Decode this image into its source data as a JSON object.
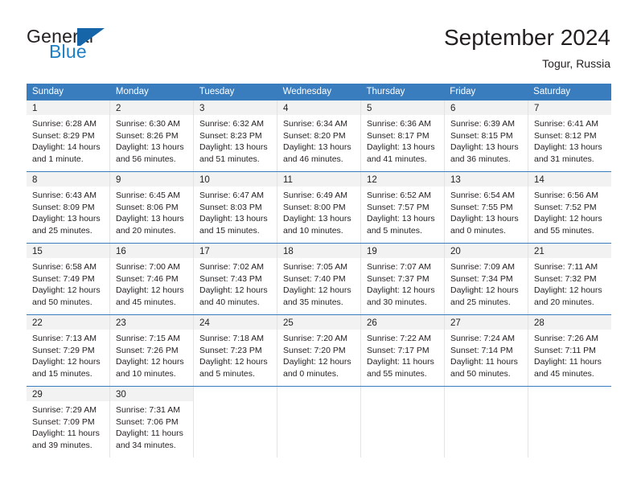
{
  "brand": {
    "name_part1": "General",
    "name_part2": "Blue",
    "flag_color": "#1665a8",
    "blue_text_color": "#1f7fc4"
  },
  "header": {
    "title": "September 2024",
    "location": "Togur, Russia"
  },
  "theme": {
    "header_row_bg": "#3a7dbf",
    "daynum_band_bg": "#f2f2f2",
    "cell_border": "#e3e3e3",
    "text": "#231f20"
  },
  "weekdays": [
    "Sunday",
    "Monday",
    "Tuesday",
    "Wednesday",
    "Thursday",
    "Friday",
    "Saturday"
  ],
  "labels": {
    "sunrise_prefix": "Sunrise:",
    "sunset_prefix": "Sunset:",
    "daylight_prefix": "Daylight:"
  },
  "weeks": [
    [
      {
        "day": "1",
        "sunrise": "Sunrise: 6:28 AM",
        "sunset": "Sunset: 8:29 PM",
        "daylight1": "Daylight: 14 hours",
        "daylight2": "and 1 minute."
      },
      {
        "day": "2",
        "sunrise": "Sunrise: 6:30 AM",
        "sunset": "Sunset: 8:26 PM",
        "daylight1": "Daylight: 13 hours",
        "daylight2": "and 56 minutes."
      },
      {
        "day": "3",
        "sunrise": "Sunrise: 6:32 AM",
        "sunset": "Sunset: 8:23 PM",
        "daylight1": "Daylight: 13 hours",
        "daylight2": "and 51 minutes."
      },
      {
        "day": "4",
        "sunrise": "Sunrise: 6:34 AM",
        "sunset": "Sunset: 8:20 PM",
        "daylight1": "Daylight: 13 hours",
        "daylight2": "and 46 minutes."
      },
      {
        "day": "5",
        "sunrise": "Sunrise: 6:36 AM",
        "sunset": "Sunset: 8:17 PM",
        "daylight1": "Daylight: 13 hours",
        "daylight2": "and 41 minutes."
      },
      {
        "day": "6",
        "sunrise": "Sunrise: 6:39 AM",
        "sunset": "Sunset: 8:15 PM",
        "daylight1": "Daylight: 13 hours",
        "daylight2": "and 36 minutes."
      },
      {
        "day": "7",
        "sunrise": "Sunrise: 6:41 AM",
        "sunset": "Sunset: 8:12 PM",
        "daylight1": "Daylight: 13 hours",
        "daylight2": "and 31 minutes."
      }
    ],
    [
      {
        "day": "8",
        "sunrise": "Sunrise: 6:43 AM",
        "sunset": "Sunset: 8:09 PM",
        "daylight1": "Daylight: 13 hours",
        "daylight2": "and 25 minutes."
      },
      {
        "day": "9",
        "sunrise": "Sunrise: 6:45 AM",
        "sunset": "Sunset: 8:06 PM",
        "daylight1": "Daylight: 13 hours",
        "daylight2": "and 20 minutes."
      },
      {
        "day": "10",
        "sunrise": "Sunrise: 6:47 AM",
        "sunset": "Sunset: 8:03 PM",
        "daylight1": "Daylight: 13 hours",
        "daylight2": "and 15 minutes."
      },
      {
        "day": "11",
        "sunrise": "Sunrise: 6:49 AM",
        "sunset": "Sunset: 8:00 PM",
        "daylight1": "Daylight: 13 hours",
        "daylight2": "and 10 minutes."
      },
      {
        "day": "12",
        "sunrise": "Sunrise: 6:52 AM",
        "sunset": "Sunset: 7:57 PM",
        "daylight1": "Daylight: 13 hours",
        "daylight2": "and 5 minutes."
      },
      {
        "day": "13",
        "sunrise": "Sunrise: 6:54 AM",
        "sunset": "Sunset: 7:55 PM",
        "daylight1": "Daylight: 13 hours",
        "daylight2": "and 0 minutes."
      },
      {
        "day": "14",
        "sunrise": "Sunrise: 6:56 AM",
        "sunset": "Sunset: 7:52 PM",
        "daylight1": "Daylight: 12 hours",
        "daylight2": "and 55 minutes."
      }
    ],
    [
      {
        "day": "15",
        "sunrise": "Sunrise: 6:58 AM",
        "sunset": "Sunset: 7:49 PM",
        "daylight1": "Daylight: 12 hours",
        "daylight2": "and 50 minutes."
      },
      {
        "day": "16",
        "sunrise": "Sunrise: 7:00 AM",
        "sunset": "Sunset: 7:46 PM",
        "daylight1": "Daylight: 12 hours",
        "daylight2": "and 45 minutes."
      },
      {
        "day": "17",
        "sunrise": "Sunrise: 7:02 AM",
        "sunset": "Sunset: 7:43 PM",
        "daylight1": "Daylight: 12 hours",
        "daylight2": "and 40 minutes."
      },
      {
        "day": "18",
        "sunrise": "Sunrise: 7:05 AM",
        "sunset": "Sunset: 7:40 PM",
        "daylight1": "Daylight: 12 hours",
        "daylight2": "and 35 minutes."
      },
      {
        "day": "19",
        "sunrise": "Sunrise: 7:07 AM",
        "sunset": "Sunset: 7:37 PM",
        "daylight1": "Daylight: 12 hours",
        "daylight2": "and 30 minutes."
      },
      {
        "day": "20",
        "sunrise": "Sunrise: 7:09 AM",
        "sunset": "Sunset: 7:34 PM",
        "daylight1": "Daylight: 12 hours",
        "daylight2": "and 25 minutes."
      },
      {
        "day": "21",
        "sunrise": "Sunrise: 7:11 AM",
        "sunset": "Sunset: 7:32 PM",
        "daylight1": "Daylight: 12 hours",
        "daylight2": "and 20 minutes."
      }
    ],
    [
      {
        "day": "22",
        "sunrise": "Sunrise: 7:13 AM",
        "sunset": "Sunset: 7:29 PM",
        "daylight1": "Daylight: 12 hours",
        "daylight2": "and 15 minutes."
      },
      {
        "day": "23",
        "sunrise": "Sunrise: 7:15 AM",
        "sunset": "Sunset: 7:26 PM",
        "daylight1": "Daylight: 12 hours",
        "daylight2": "and 10 minutes."
      },
      {
        "day": "24",
        "sunrise": "Sunrise: 7:18 AM",
        "sunset": "Sunset: 7:23 PM",
        "daylight1": "Daylight: 12 hours",
        "daylight2": "and 5 minutes."
      },
      {
        "day": "25",
        "sunrise": "Sunrise: 7:20 AM",
        "sunset": "Sunset: 7:20 PM",
        "daylight1": "Daylight: 12 hours",
        "daylight2": "and 0 minutes."
      },
      {
        "day": "26",
        "sunrise": "Sunrise: 7:22 AM",
        "sunset": "Sunset: 7:17 PM",
        "daylight1": "Daylight: 11 hours",
        "daylight2": "and 55 minutes."
      },
      {
        "day": "27",
        "sunrise": "Sunrise: 7:24 AM",
        "sunset": "Sunset: 7:14 PM",
        "daylight1": "Daylight: 11 hours",
        "daylight2": "and 50 minutes."
      },
      {
        "day": "28",
        "sunrise": "Sunrise: 7:26 AM",
        "sunset": "Sunset: 7:11 PM",
        "daylight1": "Daylight: 11 hours",
        "daylight2": "and 45 minutes."
      }
    ],
    [
      {
        "day": "29",
        "sunrise": "Sunrise: 7:29 AM",
        "sunset": "Sunset: 7:09 PM",
        "daylight1": "Daylight: 11 hours",
        "daylight2": "and 39 minutes."
      },
      {
        "day": "30",
        "sunrise": "Sunrise: 7:31 AM",
        "sunset": "Sunset: 7:06 PM",
        "daylight1": "Daylight: 11 hours",
        "daylight2": "and 34 minutes."
      },
      {
        "day": "",
        "sunrise": "",
        "sunset": "",
        "daylight1": "",
        "daylight2": ""
      },
      {
        "day": "",
        "sunrise": "",
        "sunset": "",
        "daylight1": "",
        "daylight2": ""
      },
      {
        "day": "",
        "sunrise": "",
        "sunset": "",
        "daylight1": "",
        "daylight2": ""
      },
      {
        "day": "",
        "sunrise": "",
        "sunset": "",
        "daylight1": "",
        "daylight2": ""
      },
      {
        "day": "",
        "sunrise": "",
        "sunset": "",
        "daylight1": "",
        "daylight2": ""
      }
    ]
  ]
}
